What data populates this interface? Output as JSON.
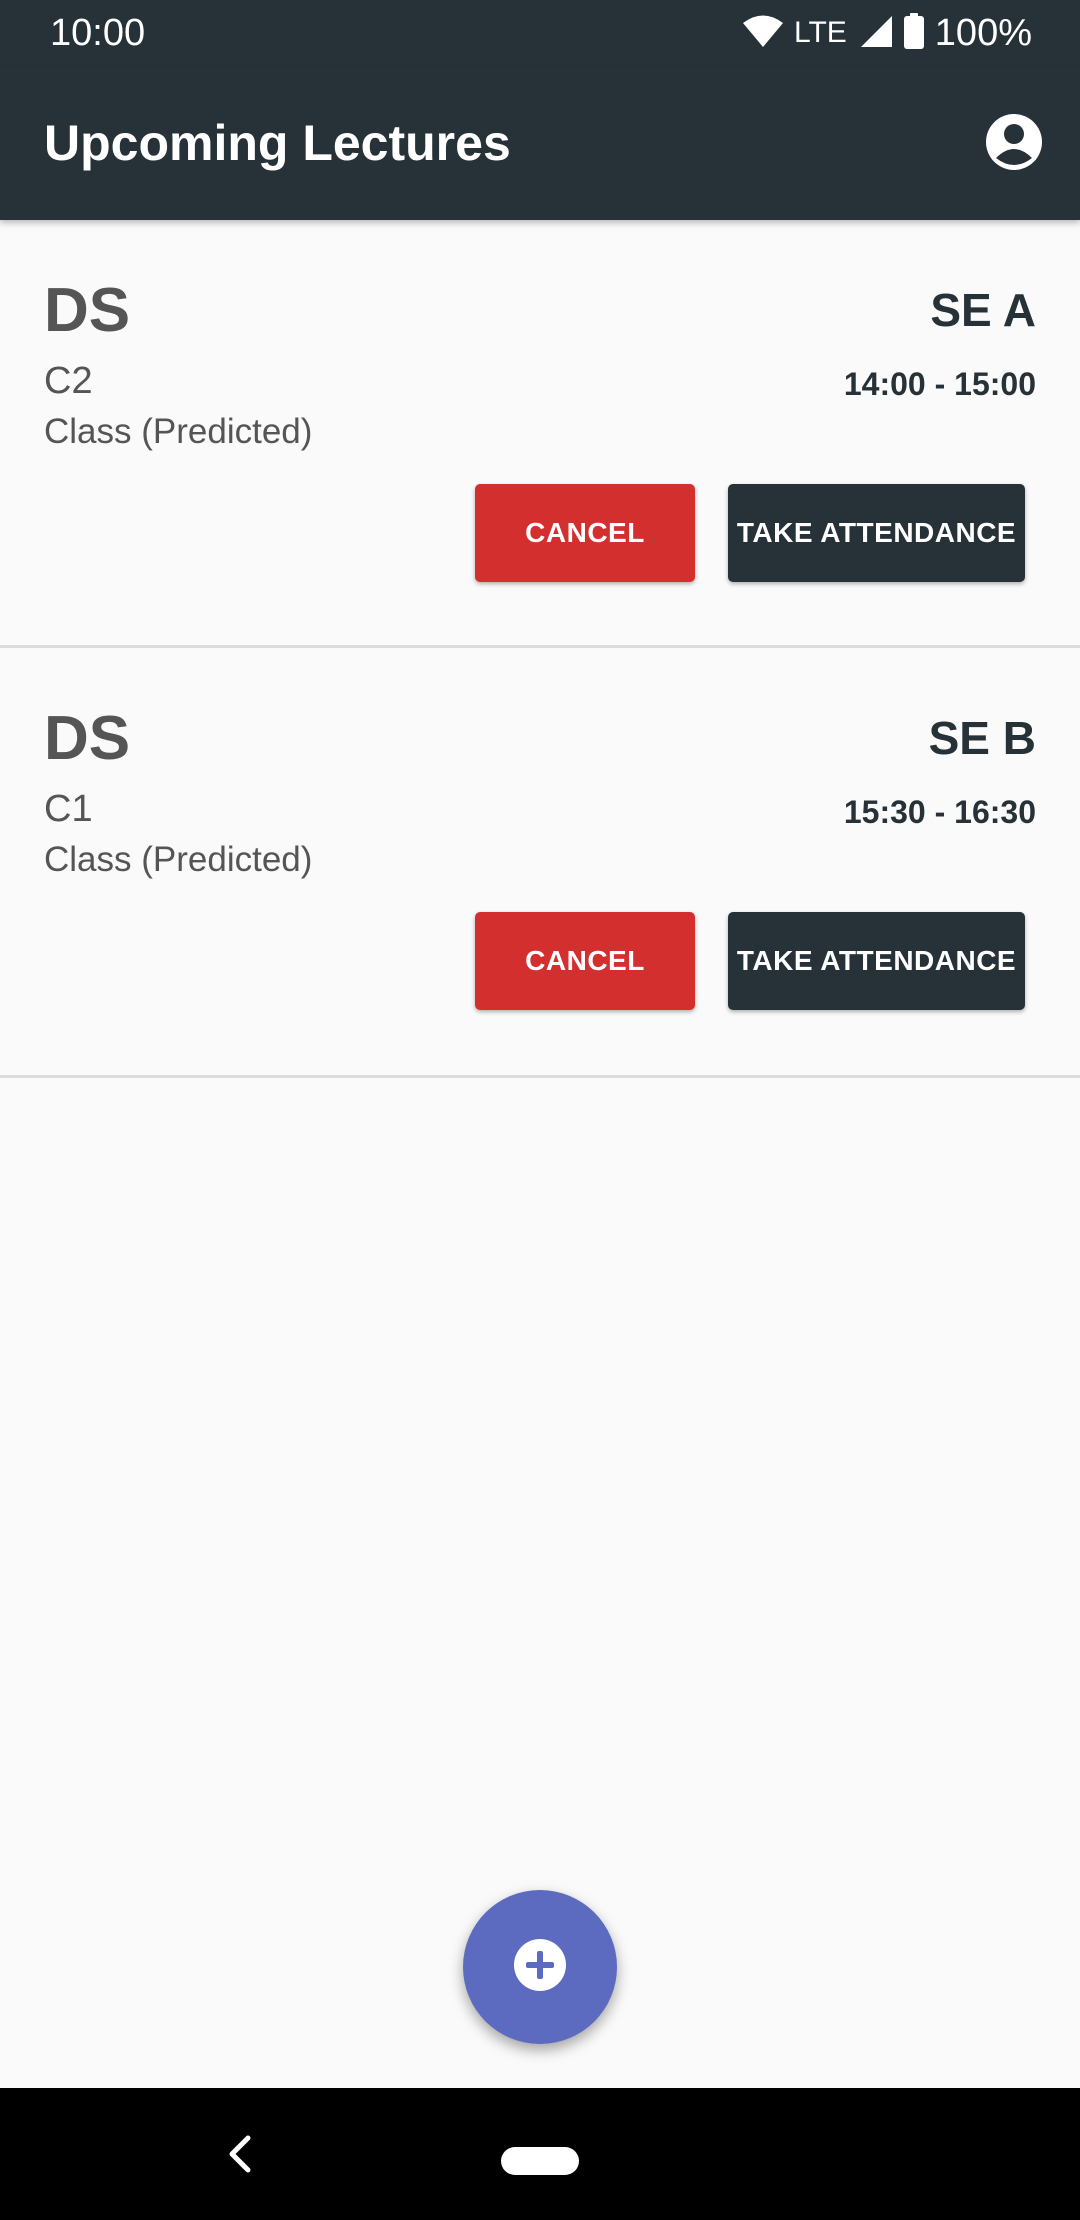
{
  "status_bar": {
    "time": "10:00",
    "network": "LTE",
    "battery": "100%",
    "icons": [
      "wifi-icon",
      "cell-signal-icon",
      "battery-icon"
    ]
  },
  "app_bar": {
    "title": "Upcoming Lectures",
    "account_icon": "account-circle-icon"
  },
  "lectures": [
    {
      "subject": "DS",
      "room": "C2",
      "type": "Class (Predicted)",
      "division": "SE A",
      "time": "14:00 - 15:00",
      "cancel_label": "CANCEL",
      "attendance_label": "TAKE ATTENDANCE"
    },
    {
      "subject": "DS",
      "room": "C1",
      "type": "Class (Predicted)",
      "division": "SE B",
      "time": "15:30 - 16:30",
      "cancel_label": "CANCEL",
      "attendance_label": "TAKE ATTENDANCE"
    }
  ],
  "fab": {
    "icon": "add-circle-icon"
  },
  "nav_bar": {
    "icons": [
      "back-icon",
      "home-pill-icon"
    ]
  },
  "colors": {
    "app_bar": "#263238",
    "background": "#fafafa",
    "cancel": "#d32f2f",
    "attendance": "#263238",
    "fab": "#5c6bc0",
    "text_secondary": "#555555"
  }
}
